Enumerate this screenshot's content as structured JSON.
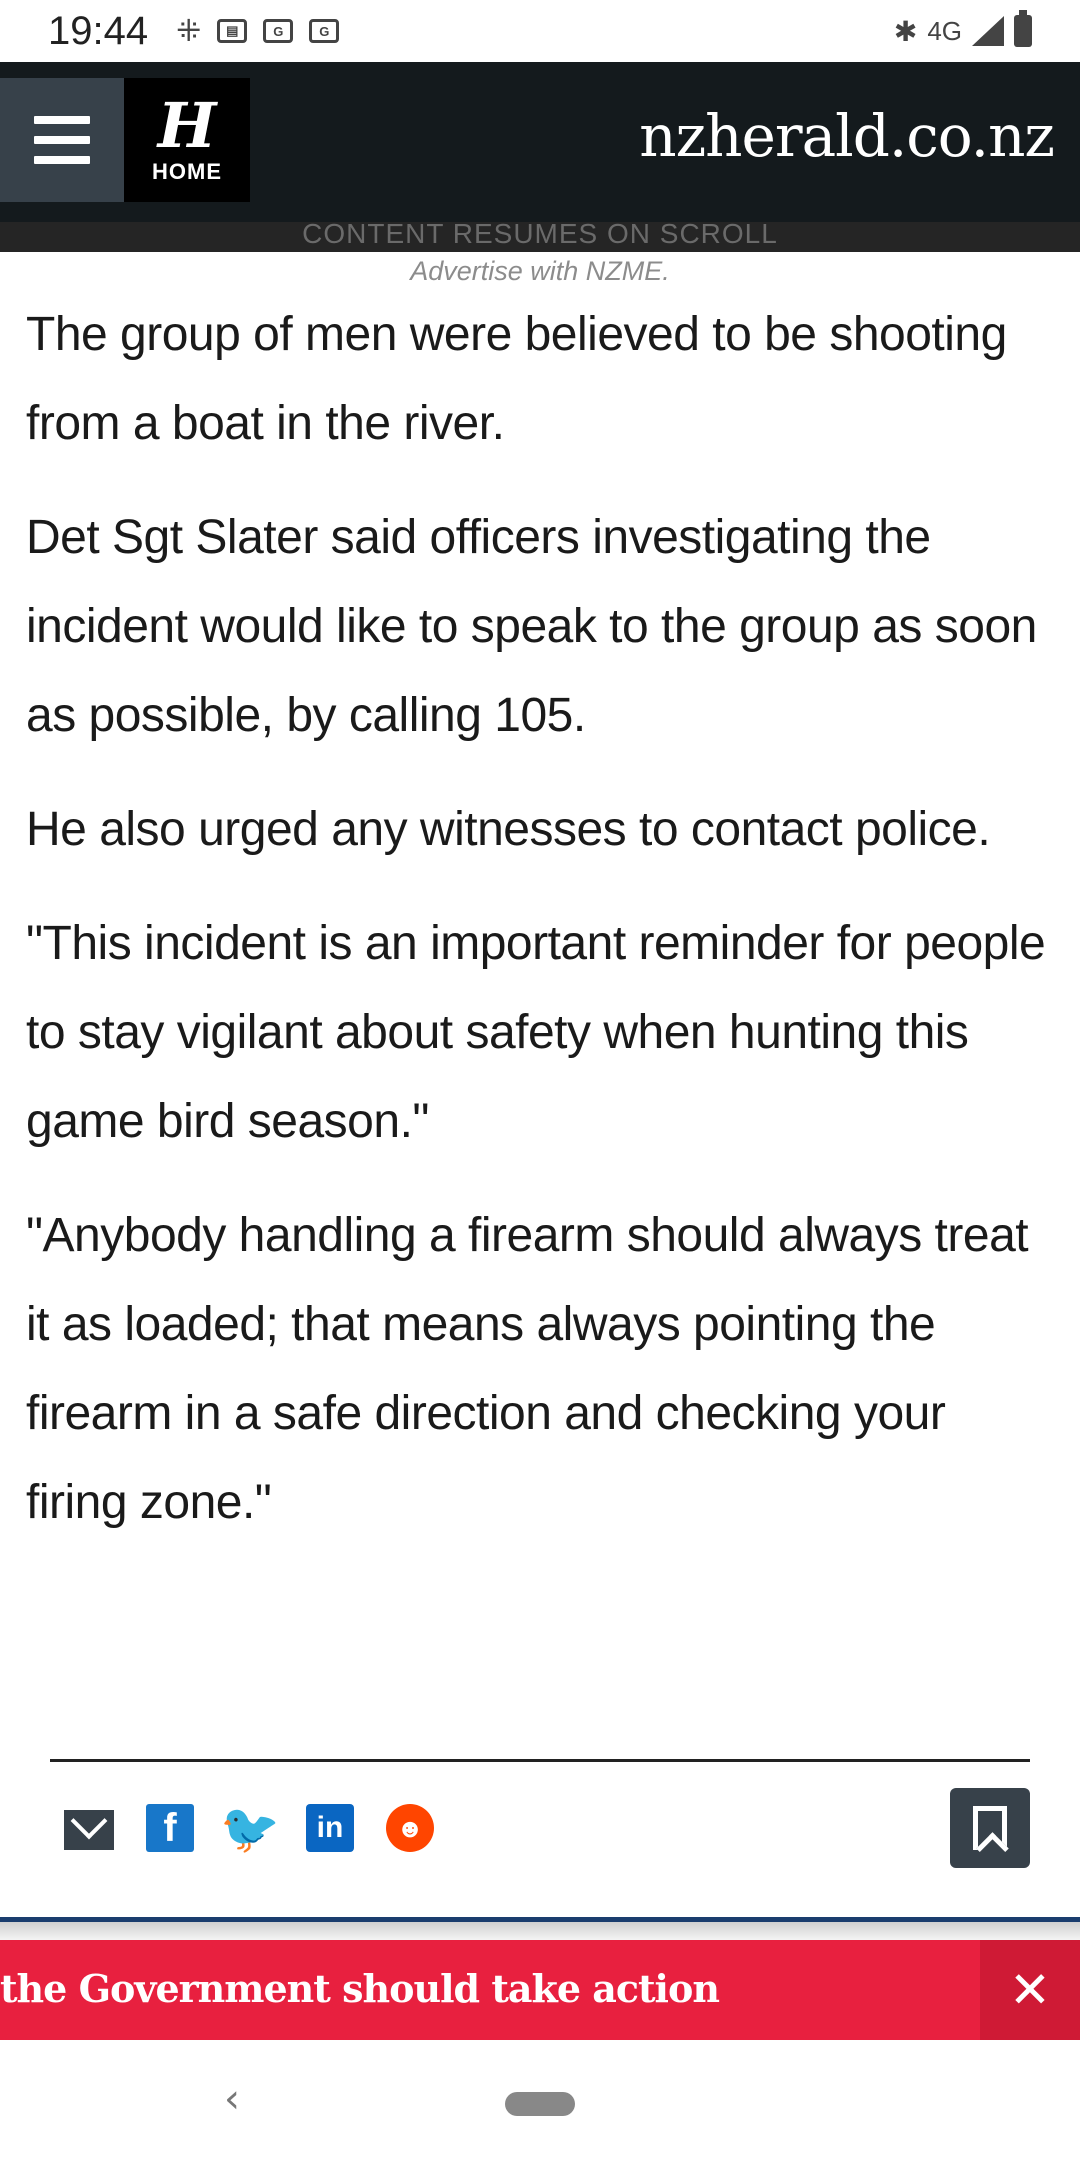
{
  "status_bar": {
    "time": "19:44",
    "notification_icons": [
      "slack-icon",
      "calendar-icon",
      "google-news-icon",
      "google-news-icon"
    ],
    "network": "4G"
  },
  "header": {
    "logo_letter": "H",
    "logo_label": "HOME",
    "site_name": "nzherald.co.nz"
  },
  "ad": {
    "strip_text": "CONTENT RESUMES ON SCROLL",
    "note": "Advertise with NZME."
  },
  "article": {
    "paragraphs": [
      "The group of men were believed to be shooting from a boat in the river.",
      "Det Sgt Slater said officers investigating the incident would like to speak to the group as soon as possible, by calling 105.",
      "He also urged any witnesses to contact police.",
      "\"This incident is an important reminder for people to stay vigilant about safety when hunting this game bird season.\"",
      "\"Anybody handling a firearm should always treat it as loaded; that means always pointing the firearm in a safe direction and checking your firing zone.\""
    ]
  },
  "share": {
    "icons": [
      "email-icon",
      "facebook-icon",
      "twitter-icon",
      "linkedin-icon",
      "reddit-icon"
    ],
    "facebook_glyph": "f",
    "twitter_glyph": "🐦",
    "linkedin_glyph": "in",
    "reddit_glyph": "☻"
  },
  "banner": {
    "text": "the Government should take action",
    "close_glyph": "✕"
  },
  "nav": {
    "back_glyph": "‹"
  },
  "colors": {
    "header_bg": "#141a1d",
    "banner_red": "#e8203f",
    "facebook": "#1877c9",
    "twitter": "#1da1f2",
    "linkedin": "#0a66c2",
    "reddit": "#ff4500"
  }
}
